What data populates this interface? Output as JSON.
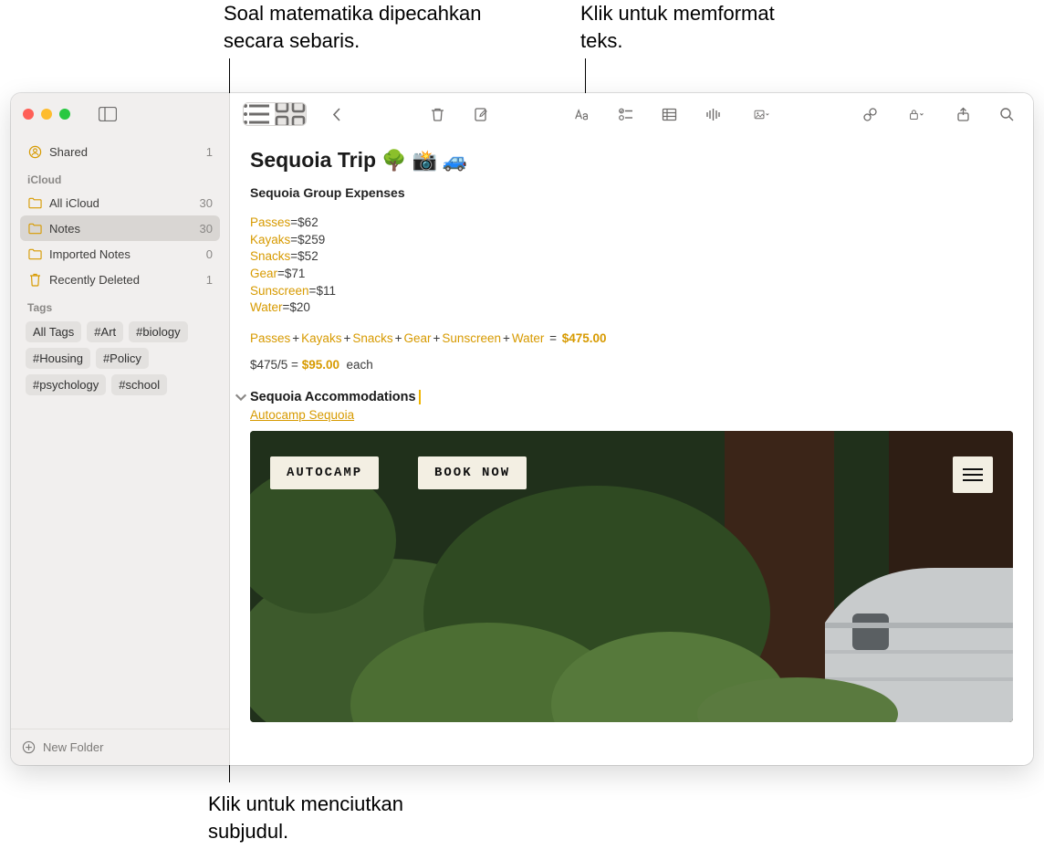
{
  "callouts": {
    "top_left": "Soal matematika dipecahkan secara sebaris.",
    "top_right": "Klik untuk memformat teks.",
    "bottom": "Klik untuk menciutkan subjudul."
  },
  "sidebar": {
    "shared": {
      "label": "Shared",
      "count": "1"
    },
    "section_icloud": "iCloud",
    "folders": [
      {
        "label": "All iCloud",
        "count": "30"
      },
      {
        "label": "Notes",
        "count": "30"
      },
      {
        "label": "Imported Notes",
        "count": "0"
      },
      {
        "label": "Recently Deleted",
        "count": "1"
      }
    ],
    "section_tags": "Tags",
    "tags": [
      "All Tags",
      "#Art",
      "#biology",
      "#Housing",
      "#Policy",
      "#psychology",
      "#school"
    ],
    "new_folder": "New Folder"
  },
  "note": {
    "title": "Sequoia Trip",
    "subtitle": "Sequoia Group Expenses",
    "expenses": [
      {
        "name": "Passes",
        "value": "$62"
      },
      {
        "name": "Kayaks",
        "value": "$259"
      },
      {
        "name": "Snacks",
        "value": "$52"
      },
      {
        "name": "Gear",
        "value": "$71"
      },
      {
        "name": "Sunscreen",
        "value": "$11"
      },
      {
        "name": "Water",
        "value": "$20"
      }
    ],
    "sum_vars": [
      "Passes",
      "Kayaks",
      "Snacks",
      "Gear",
      "Sunscreen",
      "Water"
    ],
    "sum_result": "$475.00",
    "per_prefix": "$475/5",
    "per_result": "$95.00",
    "per_suffix": "each",
    "subheading": "Sequoia Accommodations",
    "link": "Autocamp Sequoia",
    "preview": {
      "brand": "AUTOCAMP",
      "cta": "BOOK NOW"
    }
  }
}
